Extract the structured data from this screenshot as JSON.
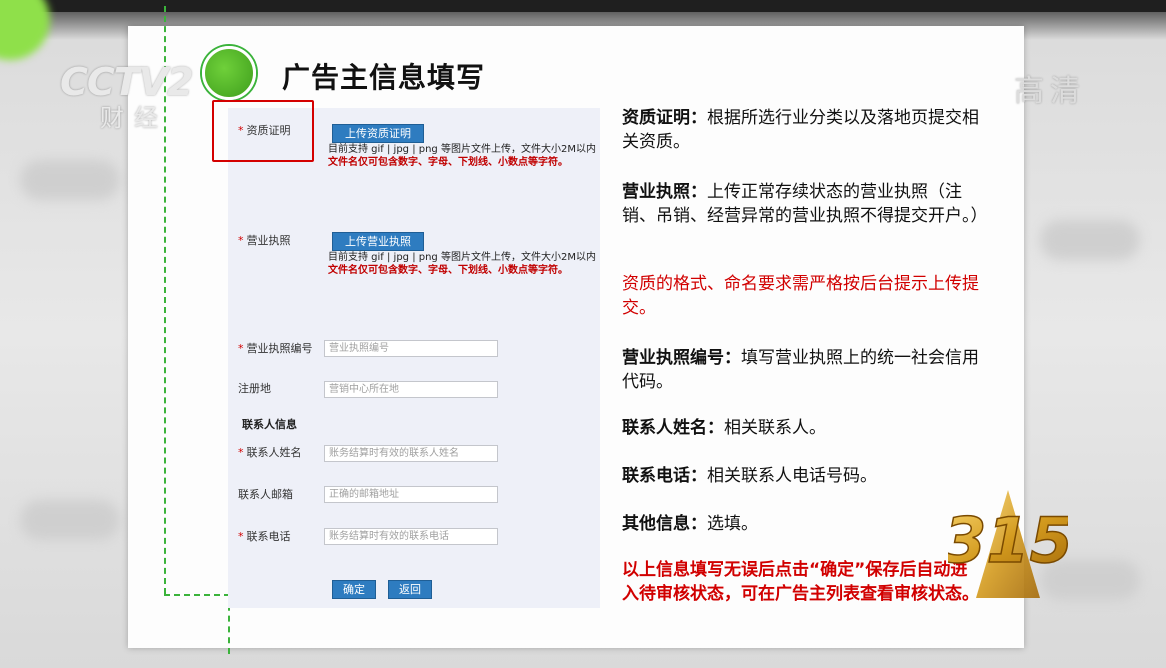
{
  "slide": {
    "title": "广告主信息填写"
  },
  "form": {
    "qualification": {
      "label": "资质证明",
      "button": "上传资质证明",
      "hint": "目前支持 gif | jpg | png 等图片文件上传，文件大小2M以内",
      "hint_red": "文件名仅可包含数字、字母、下划线、小数点等字符。"
    },
    "license": {
      "label": "营业执照",
      "button": "上传营业执照",
      "hint": "目前支持 gif | jpg | png 等图片文件上传，文件大小2M以内",
      "hint_red": "文件名仅可包含数字、字母、下划线、小数点等字符。"
    },
    "license_no": {
      "label": "营业执照编号",
      "placeholder": "营业执照编号"
    },
    "reg_address": {
      "label": "注册地",
      "placeholder": "营销中心所在地"
    },
    "contact_section": "联系人信息",
    "contact_name": {
      "label": "联系人姓名",
      "placeholder": "账务结算时有效的联系人姓名"
    },
    "contact_email": {
      "label": "联系人邮箱",
      "placeholder": "正确的邮箱地址"
    },
    "contact_phone": {
      "label": "联系电话",
      "placeholder": "账务结算时有效的联系电话"
    },
    "required_mark": "*",
    "confirm_button": "确定",
    "back_button": "返回"
  },
  "descriptions": {
    "qualification_term": "资质证明：",
    "qualification_text": "根据所选行业分类以及落地页提交相关资质。",
    "license_term": "营业执照：",
    "license_text": "上传正常存续状态的营业执照（注销、吊销、经营异常的营业执照不得提交开户。）",
    "format_note": "资质的格式、命名要求需严格按后台提示上传提交。",
    "license_no_term": "营业执照编号：",
    "license_no_text": "填写营业执照上的统一社会信用代码。",
    "contact_name_term": "联系人姓名：",
    "contact_name_text": "相关联系人。",
    "phone_term": "联系电话：",
    "phone_text": "相关联系人电话号码。",
    "other_term": "其他信息：",
    "other_text": "选填。",
    "final_note": "以上信息填写无误后点击“确定”保存后自动进入待审核状态，可在广告主列表查看审核状态。"
  },
  "broadcast": {
    "channel_logo": "CCTV2",
    "channel_name": "财经",
    "quality_mark": "高清",
    "event_mark": "315"
  },
  "colors": {
    "accent_green": "#3bb33b",
    "button_blue": "#2e7cc0",
    "warning_red": "#d10000"
  }
}
